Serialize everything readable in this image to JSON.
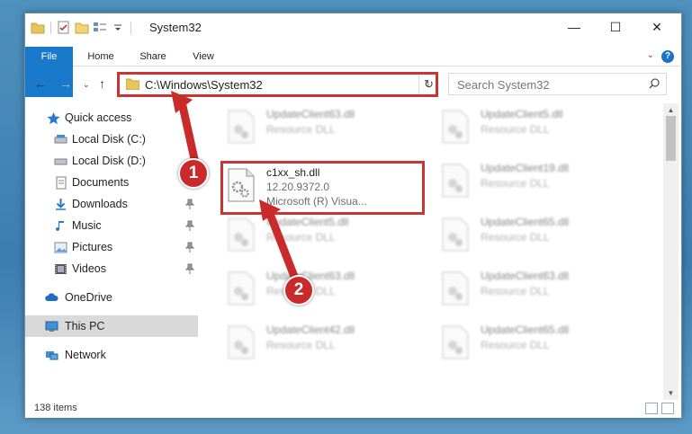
{
  "window": {
    "title": "System32",
    "controls": {
      "minimize": "—",
      "maximize": "☐",
      "close": "✕"
    }
  },
  "ribbon": {
    "tabs": [
      {
        "label": "File"
      },
      {
        "label": "Home"
      },
      {
        "label": "Share"
      },
      {
        "label": "View"
      }
    ],
    "help": "?"
  },
  "navigation": {
    "address_path": "C:\\Windows\\System32",
    "search_placeholder": "Search System32"
  },
  "sidebar": {
    "items": [
      {
        "label": "Quick access",
        "icon": "star-icon"
      },
      {
        "label": "Local Disk (C:)",
        "icon": "drive-icon"
      },
      {
        "label": "Local Disk (D:)",
        "icon": "drive-icon"
      },
      {
        "label": "Documents",
        "icon": "documents-icon"
      },
      {
        "label": "Downloads",
        "icon": "download-icon",
        "pinned": true
      },
      {
        "label": "Music",
        "icon": "music-icon",
        "pinned": true
      },
      {
        "label": "Pictures",
        "icon": "pictures-icon",
        "pinned": true
      },
      {
        "label": "Videos",
        "icon": "videos-icon",
        "pinned": true
      },
      {
        "label": "OneDrive",
        "icon": "cloud-icon"
      },
      {
        "label": "This PC",
        "icon": "computer-icon",
        "selected": true
      },
      {
        "label": "Network",
        "icon": "network-icon"
      }
    ]
  },
  "files": {
    "highlighted": {
      "name": "c1xx_sh.dll",
      "version": "12.20.9372.0",
      "description": "Microsoft (R) Visua..."
    },
    "blurred": [
      {
        "name": "UpdateClient63.dll",
        "type": "Resource DLL"
      },
      {
        "name": "UpdateClient5.dll",
        "type": "Resource DLL"
      },
      {
        "name": "UpdateClient19.dll",
        "type": "Resource DLL"
      },
      {
        "name": "UpdateClient5.dll",
        "type": "Resource DLL"
      },
      {
        "name": "UpdateClient65.dll",
        "type": "Resource DLL"
      },
      {
        "name": "UpdateClient63.dll",
        "type": "Resource DLL"
      },
      {
        "name": "UpdateClient63.dll",
        "type": "Resource DLL"
      },
      {
        "name": "UpdateClient42.dll",
        "type": "Resource DLL"
      },
      {
        "name": "UpdateClient65.dll",
        "type": "Resource DLL"
      }
    ]
  },
  "status": {
    "item_count": "138 items"
  },
  "callouts": {
    "one": "1",
    "two": "2"
  },
  "colors": {
    "accent": "#1979ca",
    "highlight": "#cc3333",
    "callout": "#c92a2a"
  }
}
